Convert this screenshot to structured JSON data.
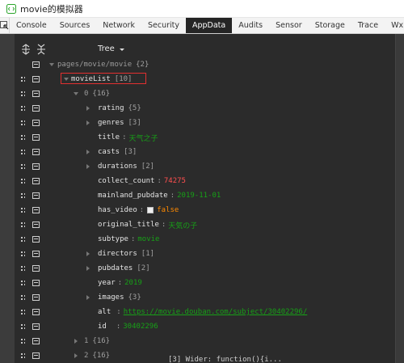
{
  "window": {
    "title": "movie的模拟器"
  },
  "tabs": [
    "Console",
    "Sources",
    "Network",
    "Security",
    "AppData",
    "Audits",
    "Sensor",
    "Storage",
    "Trace",
    "Wxml"
  ],
  "active_tab": "AppData",
  "tree_header": "Tree",
  "rows": [
    {
      "key": "pages/movie/movie",
      "meta": "{2}",
      "dim": true
    },
    {
      "key": "movieList",
      "meta": "[10]"
    },
    {
      "key": "0",
      "meta": "{16}",
      "dim": true
    },
    {
      "key": "rating",
      "meta": "{5}"
    },
    {
      "key": "genres",
      "meta": "[3]"
    },
    {
      "key": "title",
      "value": "天气之子",
      "type": "str"
    },
    {
      "key": "casts",
      "meta": "[3]"
    },
    {
      "key": "durations",
      "meta": "[2]"
    },
    {
      "key": "collect_count",
      "value": "74275",
      "type": "num"
    },
    {
      "key": "mainland_pubdate",
      "value": "2019-11-01",
      "type": "str"
    },
    {
      "key": "has_video",
      "value": "false",
      "type": "bool"
    },
    {
      "key": "original_title",
      "value": "天気の子",
      "type": "str"
    },
    {
      "key": "subtype",
      "value": "movie",
      "type": "str"
    },
    {
      "key": "directors",
      "meta": "[1]"
    },
    {
      "key": "pubdates",
      "meta": "[2]"
    },
    {
      "key": "year",
      "value": "2019",
      "type": "str"
    },
    {
      "key": "images",
      "meta": "{3}"
    },
    {
      "key": "alt",
      "value": "https://movie.douban.com/subject/30402296/",
      "type": "link"
    },
    {
      "key": "id",
      "value": "30402296",
      "type": "str"
    },
    {
      "key": "1",
      "meta": "{16}",
      "dim": true
    },
    {
      "key": "2",
      "meta": "{16}",
      "dim": true
    }
  ],
  "bottom_text": "[3]   Wider: function(){i...",
  "colors": {
    "string": "#17a017",
    "number": "#ff4f4f",
    "boolean": "#ff8a00",
    "panel": "#2b2b2b",
    "active_tab": "#252525"
  }
}
